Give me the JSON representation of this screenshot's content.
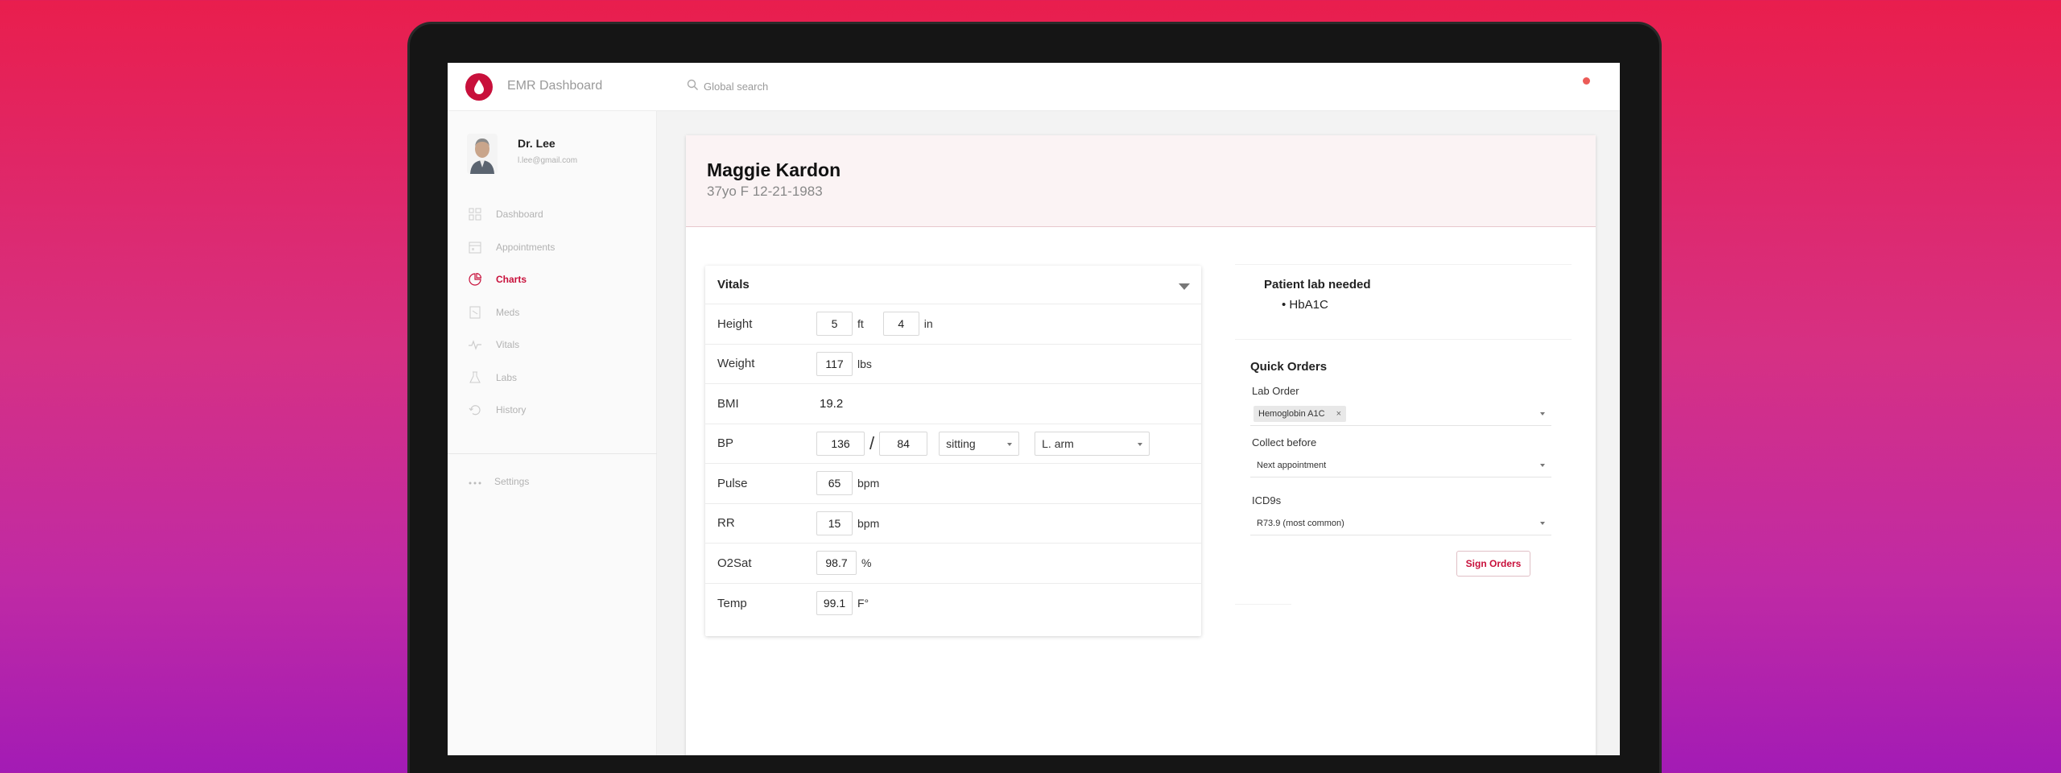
{
  "app": {
    "title": "EMR Dashboard",
    "search_placeholder": "Global search",
    "brand_color": "#c8103b",
    "notification_color": "#ec5b57"
  },
  "user": {
    "name": "Dr. Lee",
    "email": "l.lee@gmail.com"
  },
  "sidebar": {
    "items": [
      {
        "label": "Dashboard",
        "icon": "grid-icon",
        "active": false
      },
      {
        "label": "Appointments",
        "icon": "calendar-icon",
        "active": false
      },
      {
        "label": "Charts",
        "icon": "pie-chart-icon",
        "active": true
      },
      {
        "label": "Meds",
        "icon": "document-icon",
        "active": false
      },
      {
        "label": "Vitals",
        "icon": "pulse-icon",
        "active": false
      },
      {
        "label": "Labs",
        "icon": "flask-icon",
        "active": false
      },
      {
        "label": "History",
        "icon": "history-icon",
        "active": false
      }
    ],
    "settings_label": "Settings"
  },
  "patient": {
    "name": "Maggie Kardon",
    "info": "37yo F 12-21-1983"
  },
  "vitals": {
    "title": "Vitals",
    "height": {
      "label": "Height",
      "ft": "5",
      "ft_unit": "ft",
      "in": "4",
      "in_unit": "in"
    },
    "weight": {
      "label": "Weight",
      "value": "117",
      "unit": "lbs"
    },
    "bmi": {
      "label": "BMI",
      "value": "19.2"
    },
    "bp": {
      "label": "BP",
      "systolic": "136",
      "separator": "/",
      "diastolic": "84",
      "position": "sitting",
      "site": "L. arm"
    },
    "pulse": {
      "label": "Pulse",
      "value": "65",
      "unit": "bpm"
    },
    "rr": {
      "label": "RR",
      "value": "15",
      "unit": "bpm"
    },
    "o2sat": {
      "label": "O2Sat",
      "value": "98.7",
      "unit": "%"
    },
    "temp": {
      "label": "Temp",
      "value": "99.1",
      "unit": "F°"
    }
  },
  "lab_needed": {
    "title": "Patient lab needed",
    "item": "• HbA1C"
  },
  "quick_orders": {
    "title": "Quick Orders",
    "lab_order_label": "Lab Order",
    "lab_order_chip": "Hemoglobin A1C",
    "chip_remove": "×",
    "collect_before_label": "Collect before",
    "collect_before_value": "Next appointment",
    "icd9_label": "ICD9s",
    "icd9_value": "R73.9 (most common)",
    "sign_button": "Sign Orders"
  }
}
